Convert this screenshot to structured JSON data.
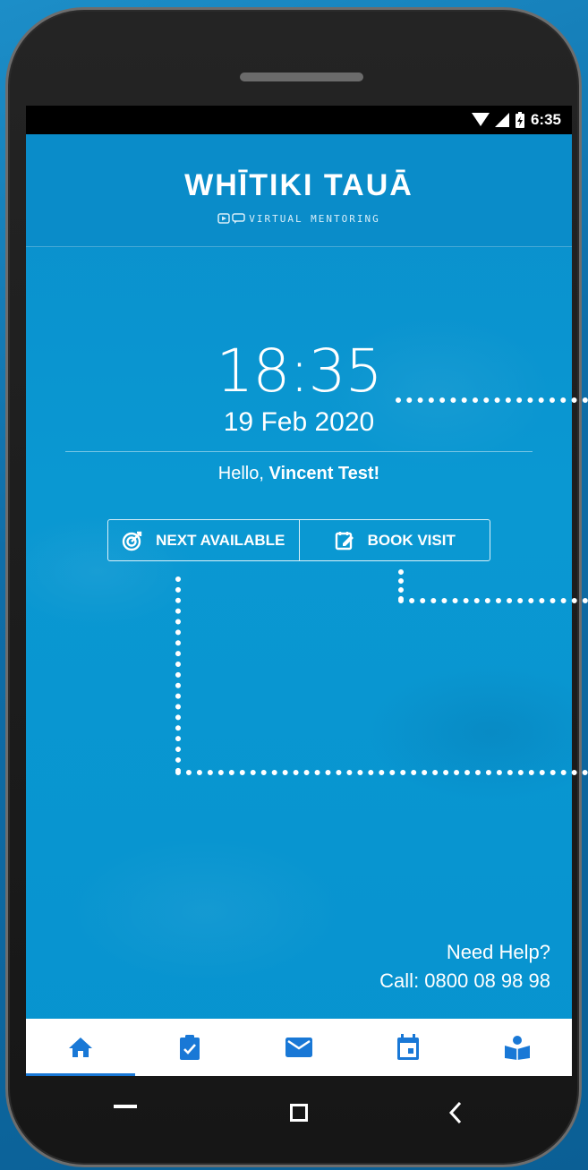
{
  "status_bar": {
    "time": "6:35"
  },
  "header": {
    "brand": "WHĪTIKI TAUĀ",
    "tagline": "VIRTUAL MENTORING"
  },
  "home": {
    "clock": "18:35",
    "date": "19 Feb 2020",
    "greeting_prefix": "Hello, ",
    "user_name": "Vincent Test!",
    "next_available_label": "NEXT AVAILABLE",
    "book_visit_label": "BOOK VISIT",
    "help_line1": "Need Help?",
    "help_line2": "Call: 0800 08 98 98"
  },
  "bottom_nav": {
    "items": [
      "home-icon",
      "tasks-icon",
      "mail-icon",
      "calendar-icon",
      "learning-icon"
    ],
    "active_index": 0,
    "active_color": "#1978d6"
  },
  "colors": {
    "screen_bg": "#0a95d0",
    "accent": "#1978d6"
  }
}
